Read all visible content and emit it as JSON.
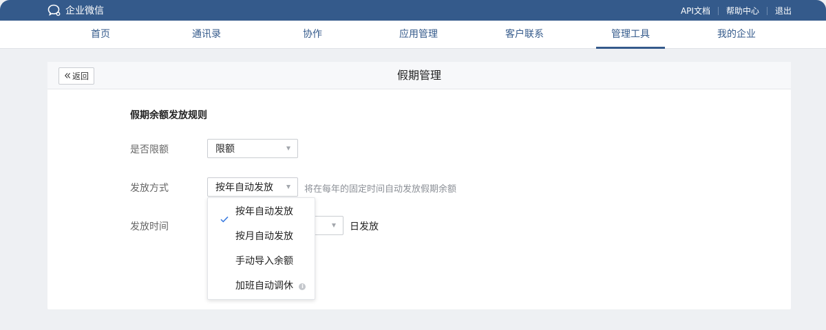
{
  "app": {
    "title": "企业微信"
  },
  "top_links": [
    "API文档",
    "帮助中心",
    "退出"
  ],
  "nav": {
    "items": [
      "首页",
      "通讯录",
      "协作",
      "应用管理",
      "客户联系",
      "管理工具",
      "我的企业"
    ],
    "active": "管理工具"
  },
  "page": {
    "back_label": "返回",
    "title": "假期管理",
    "section_title": "假期余额发放规则"
  },
  "form": {
    "limit": {
      "label": "是否限额",
      "value": "限额"
    },
    "method": {
      "label": "发放方式",
      "value": "按年自动发放",
      "hint": "将在每年的固定时间自动发放假期余额"
    },
    "time": {
      "label": "发放时间",
      "suffix": "日发放"
    }
  },
  "dropdown": {
    "options": [
      "按年自动发放",
      "按月自动发放",
      "手动导入余额",
      "加班自动调休"
    ],
    "selected": "按年自动发放"
  },
  "colors": {
    "brand": "#345a8b",
    "check": "#3a7be0"
  }
}
